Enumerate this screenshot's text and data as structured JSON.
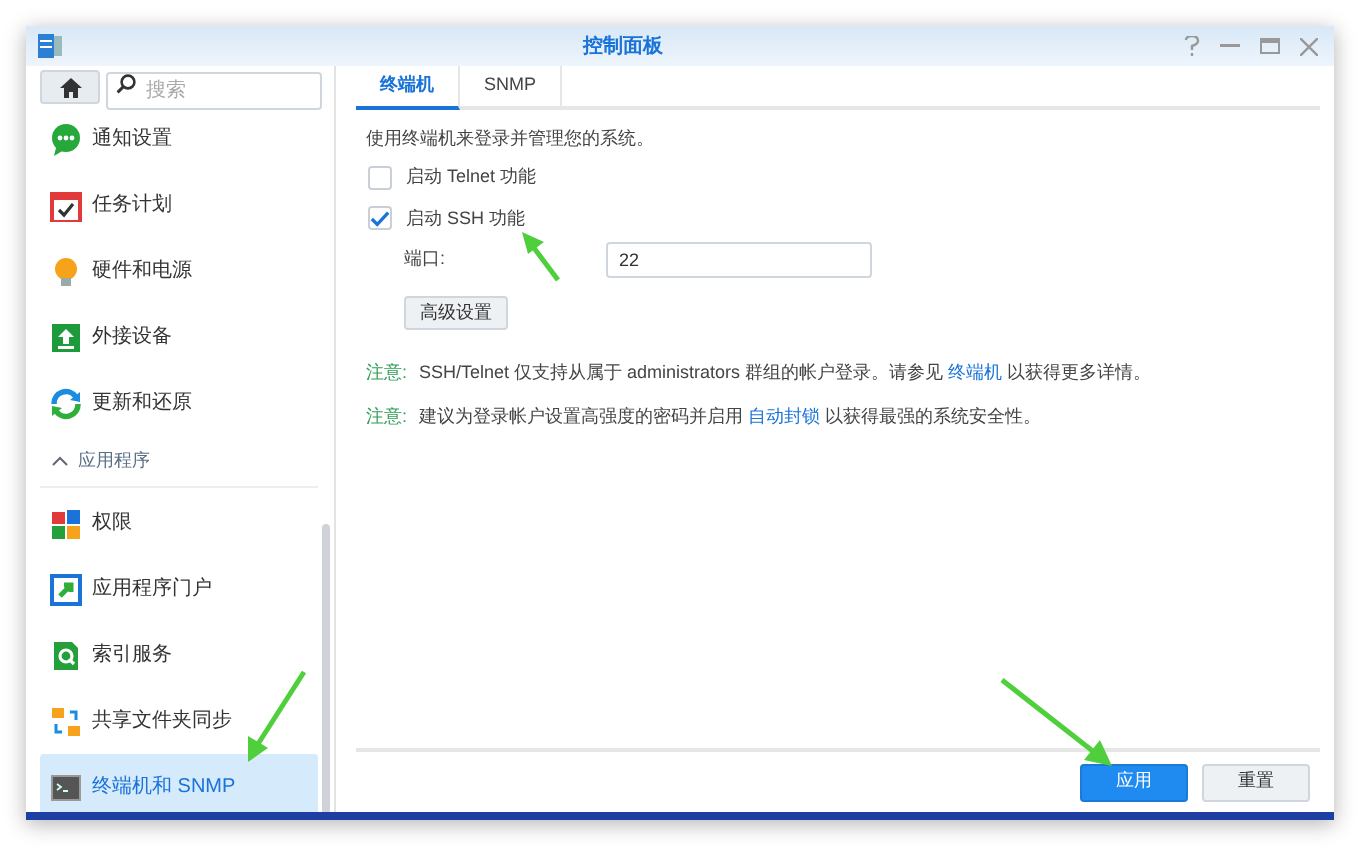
{
  "window": {
    "title": "控制面板"
  },
  "sidebar": {
    "search": {
      "placeholder": "搜索"
    },
    "items": [
      {
        "label": "通知设置",
        "selected": false
      },
      {
        "label": "任务计划",
        "selected": false
      },
      {
        "label": "硬件和电源",
        "selected": false
      },
      {
        "label": "外接设备",
        "selected": false
      },
      {
        "label": "更新和还原",
        "selected": false
      }
    ],
    "section": {
      "label": "应用程序",
      "expanded": true,
      "items": [
        {
          "label": "权限",
          "selected": false
        },
        {
          "label": "应用程序门户",
          "selected": false
        },
        {
          "label": "索引服务",
          "selected": false
        },
        {
          "label": "共享文件夹同步",
          "selected": false
        },
        {
          "label": "终端机和 SNMP",
          "selected": true
        }
      ]
    }
  },
  "tabs": [
    {
      "label": "终端机",
      "selected": true
    },
    {
      "label": "SNMP",
      "selected": false
    }
  ],
  "intro": "使用终端机来登录并管理您的系统。",
  "options": [
    {
      "label": "启动 Telnet 功能",
      "checked": false
    },
    {
      "label": "启动 SSH 功能",
      "checked": true
    }
  ],
  "port": {
    "label": "端口:",
    "value": "22"
  },
  "advanced_button": "高级设置",
  "notes": [
    {
      "label": "注意:",
      "before": "SSH/Telnet 仅支持从属于 administrators 群组的帐户登录。请参见",
      "link": "终端机",
      "after": "以获得更多详情。"
    },
    {
      "label": "注意:",
      "before": "建议为登录帐户设置高强度的密码并启用",
      "link": "自动封锁",
      "after": "以获得最强的系统安全性。"
    }
  ],
  "buttons": [
    {
      "label": "应用",
      "kind": "primary"
    },
    {
      "label": "重置",
      "kind": "secondary"
    }
  ]
}
